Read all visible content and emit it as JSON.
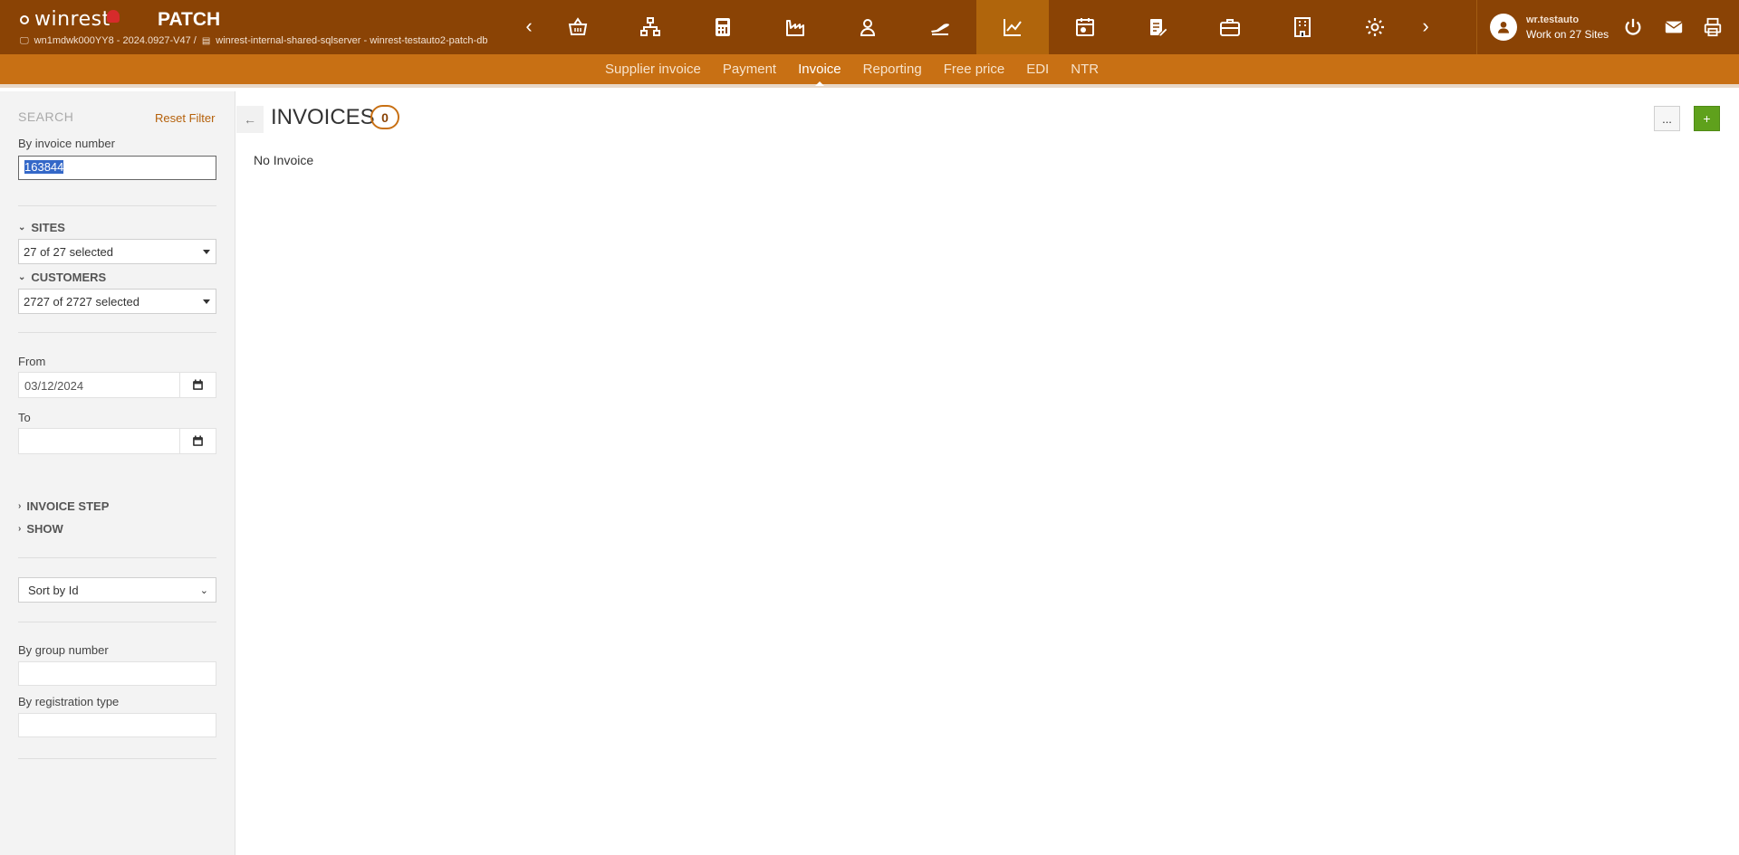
{
  "header": {
    "logo_text": "winrest",
    "app_name": "PATCH",
    "machine": "wn1mdwk000YY8 - 2024.0927-V47 /",
    "database": "winrest-internal-shared-sqlserver - winrest-testauto2-patch-db",
    "nav_icons": [
      "basket-icon",
      "sitemap-icon",
      "calculator-icon",
      "factory-icon",
      "user-icon",
      "plane-icon",
      "chart-line-icon",
      "calendar-gear-icon",
      "clipboard-edit-icon",
      "briefcase-icon",
      "building-icon",
      "gear-icon"
    ],
    "active_nav": "chart-line-icon",
    "user": {
      "name": "wr.testauto",
      "sites": "Work on 27 Sites"
    }
  },
  "subnav": {
    "items": [
      "Supplier invoice",
      "Payment",
      "Invoice",
      "Reporting",
      "Free price",
      "EDI",
      "NTR"
    ],
    "active": "Invoice"
  },
  "sidebar": {
    "title": "SEARCH",
    "reset_label": "Reset Filter",
    "invoice_number_label": "By invoice number",
    "invoice_number_value": "163844",
    "sites_label": "SITES",
    "sites_value": "27 of 27 selected",
    "customers_label": "CUSTOMERS",
    "customers_value": "2727 of 2727 selected",
    "from_label": "From",
    "from_value": "03/12/2024",
    "to_label": "To",
    "to_value": "",
    "invoice_step_label": "INVOICE STEP",
    "show_label": "SHOW",
    "sort_value": "Sort by Id",
    "group_number_label": "By group number",
    "registration_type_label": "By registration type"
  },
  "main": {
    "title": "INVOICES",
    "count": "0",
    "empty_message": "No Invoice",
    "more_label": "...",
    "add_label": "+"
  },
  "colors": {
    "header_bg": "#8a4305",
    "subnav_bg": "#c87014",
    "active_nav_bg": "#b0650c",
    "accent": "#b5610b",
    "add_button": "#5fa11c"
  }
}
